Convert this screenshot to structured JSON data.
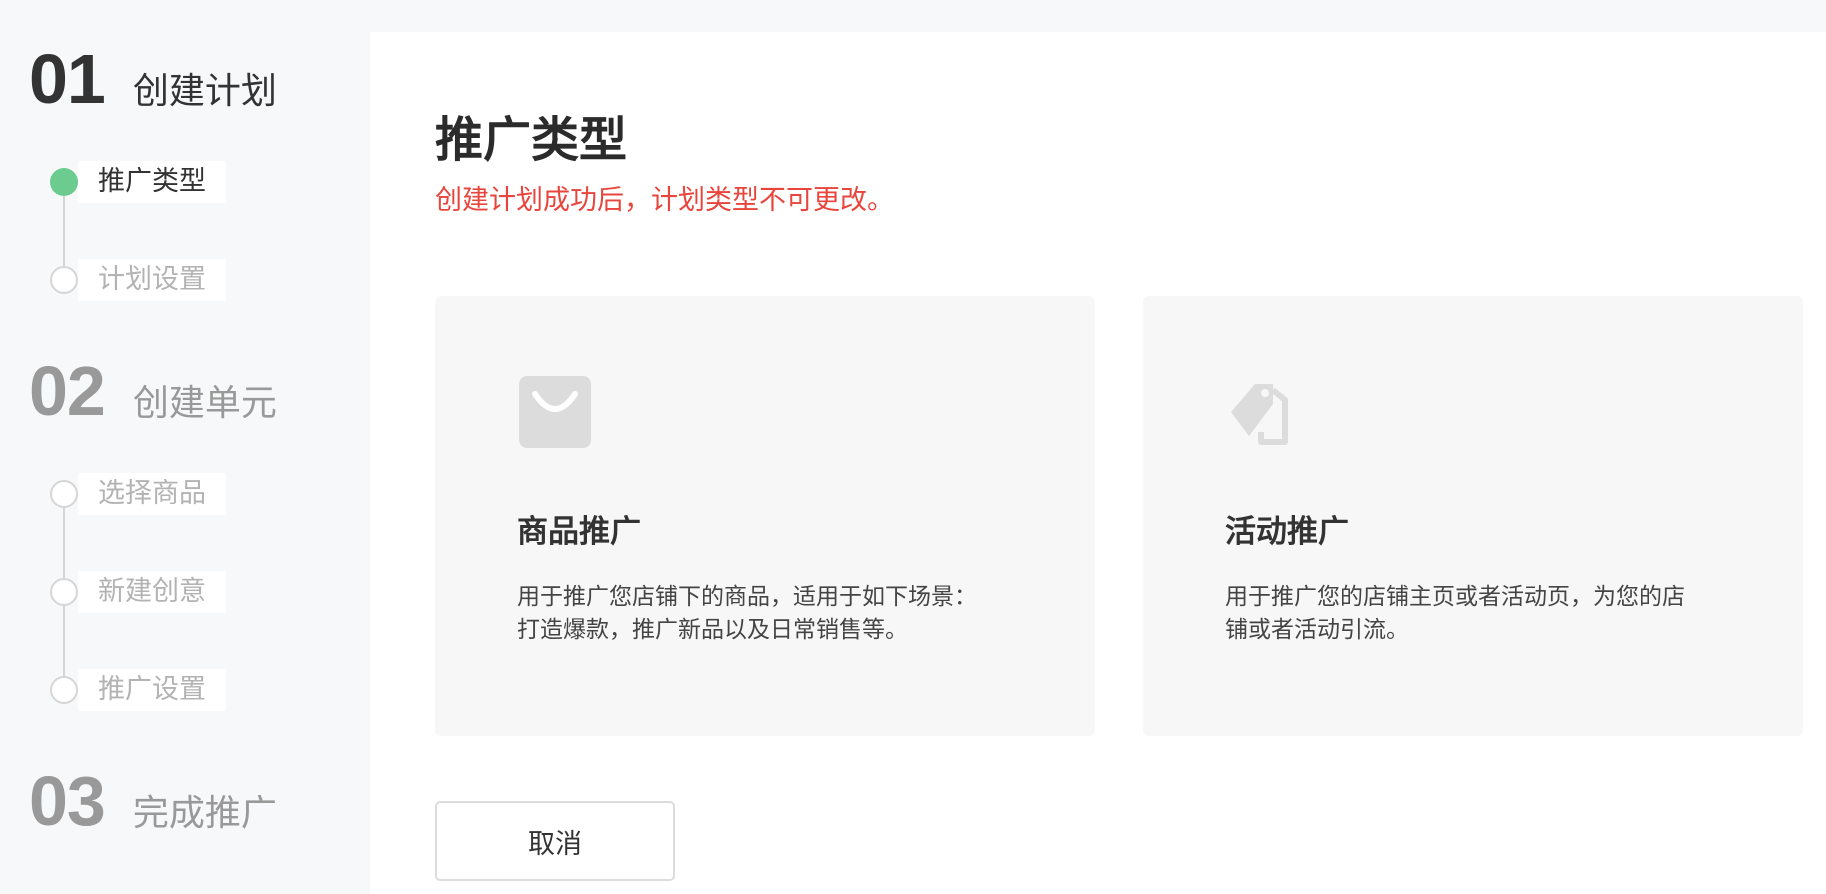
{
  "sidebar": {
    "phases": [
      {
        "number": "01",
        "title": "创建计划"
      },
      {
        "number": "02",
        "title": "创建单元"
      },
      {
        "number": "03",
        "title": "完成推广"
      }
    ],
    "steps": [
      {
        "label": "推广类型",
        "status": "done"
      },
      {
        "label": "计划设置",
        "status": "pending"
      },
      {
        "label": "选择商品",
        "status": "pending"
      },
      {
        "label": "新建创意",
        "status": "pending"
      },
      {
        "label": "推广设置",
        "status": "pending"
      }
    ]
  },
  "main": {
    "title": "推广类型",
    "warning": "创建计划成功后，计划类型不可更改。",
    "cards": [
      {
        "icon": "shopping-bag-icon",
        "title": "商品推广",
        "desc_line1": "用于推广您店铺下的商品，适用于如下场景：",
        "desc_line2": "打造爆款，推广新品以及日常销售等。"
      },
      {
        "icon": "price-tag-icon",
        "title": "活动推广",
        "desc_line1": "用于推广您的店铺主页或者活动页，为您的店",
        "desc_line2": "铺或者活动引流。"
      }
    ],
    "cancel_label": "取消"
  },
  "colors": {
    "accent_green": "#6ccb8f",
    "warning_red": "#e8453c",
    "active_text": "#333333",
    "inactive_text": "#999999"
  }
}
